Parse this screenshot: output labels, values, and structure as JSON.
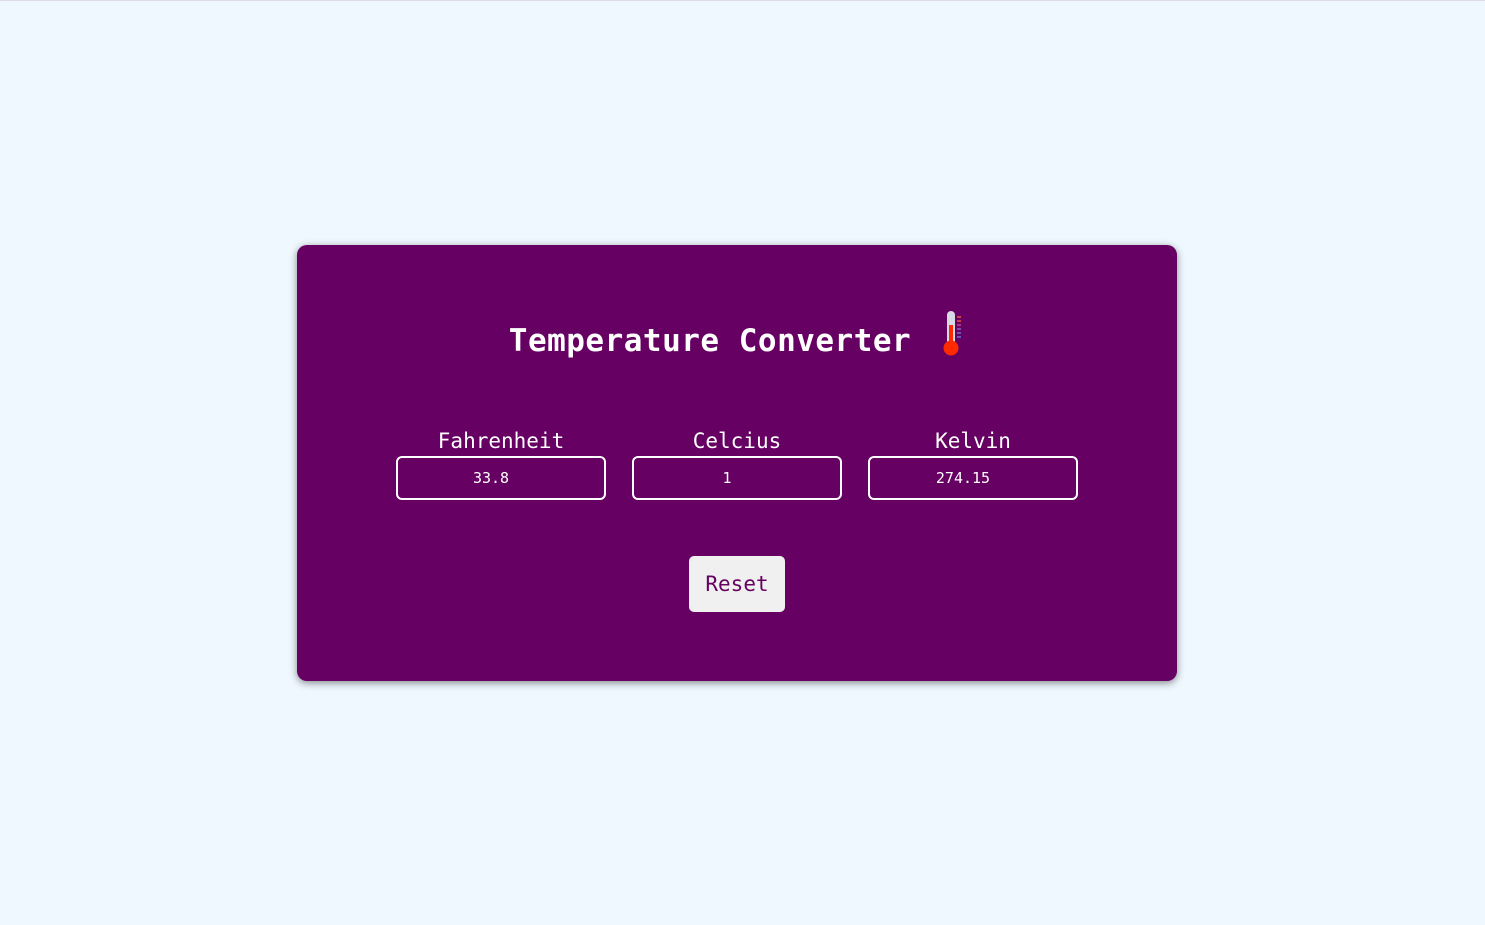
{
  "app": {
    "title": "Temperature Converter",
    "title_icon": "thermometer-icon"
  },
  "fields": [
    {
      "label": "Fahrenheit",
      "value": "33.8"
    },
    {
      "label": "Celcius",
      "value": "1"
    },
    {
      "label": "Kelvin",
      "value": "274.15"
    }
  ],
  "reset_button": {
    "label": "Reset"
  },
  "colors": {
    "page_background": "#eff7ff",
    "card_background": "#660062",
    "text": "#ffffff",
    "button_background": "#f0f0f0",
    "button_text": "#660062",
    "thermometer_red": "#ff2a00"
  }
}
